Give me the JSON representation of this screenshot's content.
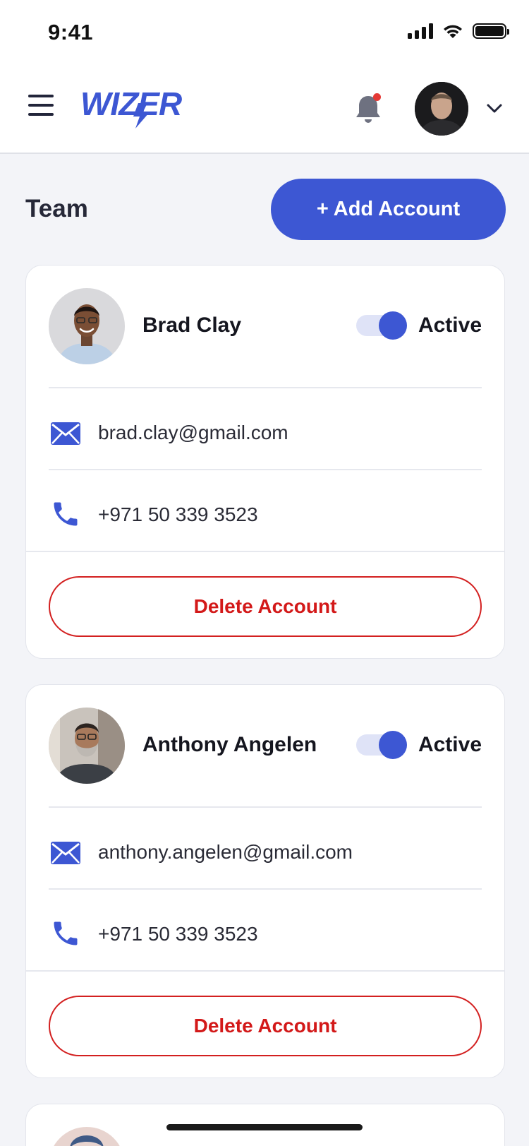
{
  "status_bar": {
    "time": "9:41"
  },
  "header": {
    "logo_text": "WIZER",
    "notification_dot": true
  },
  "page": {
    "section_title": "Team",
    "add_button_label": "+ Add Account"
  },
  "accounts": [
    {
      "name": "Brad Clay",
      "status": "Active",
      "active": true,
      "email": "brad.clay@gmail.com",
      "phone": "+971 50 339 3523",
      "delete_label": "Delete Account"
    },
    {
      "name": "Anthony Angelen",
      "status": "Active",
      "active": true,
      "email": "anthony.angelen@gmail.com",
      "phone": "+971 50 339 3523",
      "delete_label": "Delete Account"
    }
  ],
  "colors": {
    "accent": "#3d57d3",
    "danger": "#d31919",
    "background": "#f3f4f8",
    "toggle_track": "#dfe3f7"
  },
  "icons": [
    "menu-icon",
    "bell-icon",
    "chevron-down-icon",
    "mail-icon",
    "phone-icon",
    "signal-icon",
    "wifi-icon",
    "battery-icon"
  ]
}
